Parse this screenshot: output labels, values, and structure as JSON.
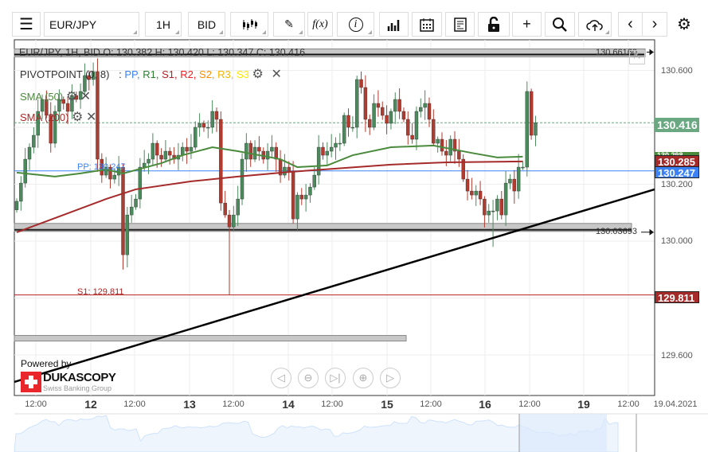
{
  "toolbar": {
    "instrument": "EUR/JPY",
    "period": "1H",
    "side": "BID",
    "fx_label": "f(x)",
    "info_label": "i"
  },
  "header": {
    "ohlc": "EUR/JPY, 1H, BID  O: 130.382 H: 130.420 L: 130.347 C: 130.416"
  },
  "indicators": {
    "pivot": "PIVOTPOINT (0, 8)",
    "pivot_sep": ":",
    "pivot_levels": [
      {
        "name": "PP",
        "color": "#3b82f6"
      },
      {
        "name": "R1",
        "color": "#2e7d32"
      },
      {
        "name": "S1",
        "color": "#b22222"
      },
      {
        "name": "R2",
        "color": "#ff1a1a"
      },
      {
        "name": "S2",
        "color": "#ff8c00"
      },
      {
        "name": "R3",
        "color": "#f2b600"
      },
      {
        "name": "S3",
        "color": "#ffe600"
      }
    ],
    "sma50": "SMA (50)",
    "sma200": "SMA (200)"
  },
  "levels": {
    "pp_label": "PP: 130.247",
    "pp": 130.247,
    "s1_label": "S1: 129.811",
    "s1": 129.811,
    "zone_top_label": "130.66160",
    "zone_top": 130.6616,
    "zone_bottom_label": "130.03693",
    "zone_bottom": 130.03693,
    "zone_low": 129.66
  },
  "price_tags": {
    "current": "130.416",
    "sma200": "130.285",
    "sma50": "130.298",
    "pp": "130.247",
    "s1": "129.811"
  },
  "colors": {
    "up": "#4a8a5c",
    "down": "#b23a2e",
    "sma50": "#4a8a3c",
    "sma200": "#a52a2a",
    "pp": "#3b82f6",
    "s1": "#b22222",
    "current": "#6aa882"
  },
  "branding": {
    "powered": "Powered by",
    "name": "DUKASCOPY",
    "sub": "Swiss Banking Group"
  },
  "chart_data": {
    "type": "candlestick",
    "title": "EUR/JPY, 1H, BID",
    "y_ticks": [
      "130.600",
      "130.200",
      "130.000",
      "129.600"
    ],
    "y_tick_values": [
      130.6,
      130.2,
      130.0,
      129.6
    ],
    "x_ticks": [
      "12:00",
      "12",
      "12:00",
      "13",
      "12:00",
      "14",
      "12:00",
      "15",
      "12:00",
      "16",
      "12:00",
      "19",
      "12:00",
      "19.04.2021"
    ],
    "closes": [
      130.14,
      130.204,
      130.288,
      130.33,
      130.372,
      130.456,
      130.498,
      130.442,
      130.344,
      130.456,
      130.498,
      130.484,
      130.456,
      130.512,
      130.498,
      130.526,
      130.582,
      130.568,
      130.596,
      130.288,
      130.232,
      130.26,
      130.218,
      130.232,
      130.26,
      129.952,
      130.092,
      130.12,
      130.148,
      130.26,
      130.274,
      130.288,
      130.344,
      130.302,
      130.288,
      130.316,
      130.302,
      130.288,
      130.302,
      130.33,
      130.316,
      130.33,
      130.4,
      130.414,
      130.4,
      130.4,
      130.456,
      130.428,
      130.134,
      130.092,
      130.05,
      130.092,
      130.148,
      130.288,
      130.344,
      130.288,
      130.33,
      130.316,
      130.288,
      130.316,
      130.33,
      130.288,
      130.232,
      130.26,
      130.246,
      130.078,
      130.162,
      130.148,
      130.162,
      130.19,
      130.232,
      130.33,
      130.302,
      130.316,
      130.33,
      130.344,
      130.344,
      130.442,
      130.4,
      130.4,
      130.568,
      130.54,
      130.428,
      130.4,
      130.484,
      130.47,
      130.442,
      130.414,
      130.456,
      130.498,
      130.456,
      130.428,
      130.372,
      130.358,
      130.456,
      130.47,
      130.484,
      130.428,
      130.344,
      130.358,
      130.316,
      130.302,
      130.358,
      130.316,
      130.288,
      130.218,
      130.176,
      130.162,
      130.176,
      130.148,
      130.092,
      130.106,
      130.106,
      130.148,
      130.092,
      130.204,
      130.218,
      130.176,
      130.26,
      130.26,
      130.526,
      130.372,
      130.416
    ],
    "low_overrides": [
      {
        "i": 25,
        "v": 129.9
      },
      {
        "i": 50,
        "v": 129.811
      },
      {
        "i": 112,
        "v": 129.98
      }
    ],
    "sma50": [
      [
        0,
        130.241
      ],
      [
        9,
        130.227
      ],
      [
        15,
        130.238
      ],
      [
        21,
        130.252
      ],
      [
        25,
        130.238
      ],
      [
        34,
        130.274
      ],
      [
        39,
        130.302
      ],
      [
        46,
        130.33
      ],
      [
        52,
        130.316
      ],
      [
        62,
        130.288
      ],
      [
        66,
        130.26
      ],
      [
        73,
        130.266
      ],
      [
        79,
        130.302
      ],
      [
        88,
        130.33
      ],
      [
        98,
        130.336
      ],
      [
        107,
        130.31
      ],
      [
        113,
        130.294
      ],
      [
        119,
        130.297
      ]
    ],
    "sma200": [
      [
        0,
        130.031
      ],
      [
        11,
        130.092
      ],
      [
        21,
        130.148
      ],
      [
        28,
        130.182
      ],
      [
        41,
        130.21
      ],
      [
        52,
        130.227
      ],
      [
        64,
        130.243
      ],
      [
        75,
        130.255
      ],
      [
        88,
        130.269
      ],
      [
        101,
        130.277
      ],
      [
        119,
        130.28
      ]
    ],
    "trendline": {
      "start_price": 129.505,
      "end_price": 130.182
    },
    "ylim": [
      129.48,
      130.69
    ]
  }
}
